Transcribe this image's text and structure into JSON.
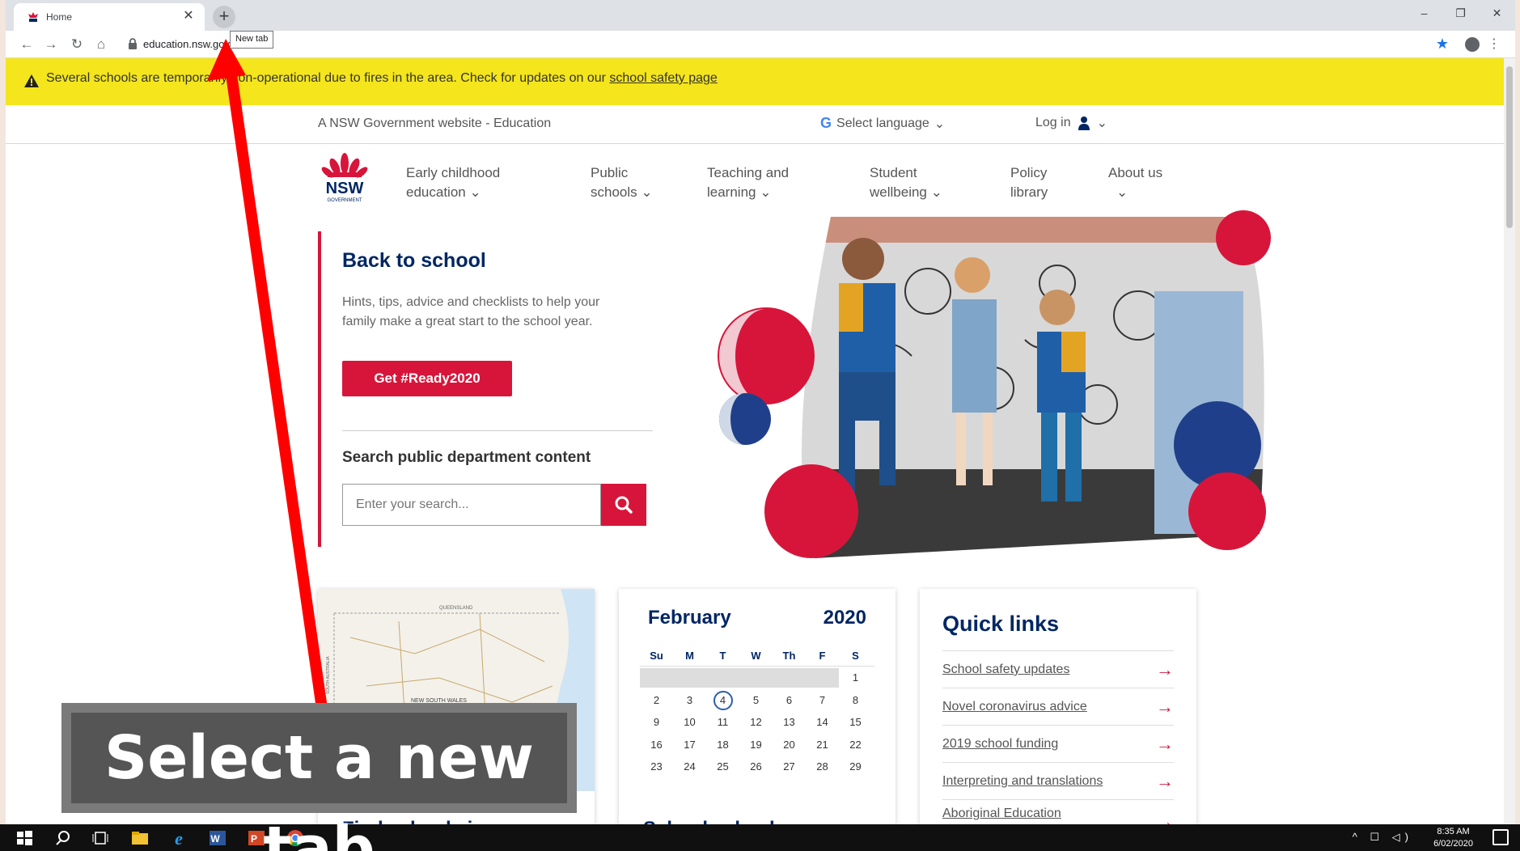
{
  "browser": {
    "tab_title": "Home",
    "close_glyph": "✕",
    "newtab_glyph": "+",
    "tooltip": "New tab",
    "url": "education.nsw.gov",
    "win_minimize": "–",
    "win_restore": "❐",
    "win_close": "✕",
    "back": "←",
    "forward": "→",
    "reload": "↻",
    "home": "⌂",
    "star": "★",
    "menu": "⋮"
  },
  "alert": {
    "text": "Several schools are temporarily non-operational due to fires in the area. Check for updates on our ",
    "link": "school safety page"
  },
  "topbar": {
    "site_label": "A NSW Government website - Education",
    "language": "Select language",
    "login": "Log in",
    "chevron": "⌄"
  },
  "nav": [
    {
      "line1": "Early childhood",
      "line2": "education"
    },
    {
      "line1": "Public",
      "line2": "schools"
    },
    {
      "line1": "Teaching and",
      "line2": "learning"
    },
    {
      "line1": "Student",
      "line2": "wellbeing"
    },
    {
      "line1": "Policy",
      "line2": "library"
    },
    {
      "line1": "About us",
      "line2": ""
    }
  ],
  "nav_chevron": "⌄",
  "logo": {
    "text": "NSW",
    "sub": "GOVERNMENT"
  },
  "hero": {
    "title": "Back to school",
    "desc": "Hints, tips, advice and checklists to help your family make a great start to the school year.",
    "cta": "Get #Ready2020",
    "search_title": "Search public department content",
    "search_placeholder": "Enter your search..."
  },
  "map_card": {
    "bottom_title": "Find schools in",
    "labels": {
      "region1": "QUEENSLAND",
      "region2": "NEW SOUTH WALES",
      "region3": "SOUTH AUSTRALIA"
    }
  },
  "calendar": {
    "month": "February",
    "year": "2020",
    "days": [
      "Su",
      "M",
      "T",
      "W",
      "Th",
      "F",
      "S"
    ],
    "weeks": [
      [
        "",
        "",
        "",
        "",
        "",
        "",
        "1"
      ],
      [
        "2",
        "3",
        "4",
        "5",
        "6",
        "7",
        "8"
      ],
      [
        "9",
        "10",
        "11",
        "12",
        "13",
        "14",
        "15"
      ],
      [
        "16",
        "17",
        "18",
        "19",
        "20",
        "21",
        "22"
      ],
      [
        "23",
        "24",
        "25",
        "26",
        "27",
        "28",
        "29"
      ]
    ],
    "today": "4",
    "bottom_title": "School calendar"
  },
  "quick_links": {
    "title": "Quick links",
    "items": [
      "School safety updates",
      "Novel coronavirus advice",
      "2019 school funding",
      "Interpreting and translations",
      "Aboriginal Education"
    ],
    "arrow": "→"
  },
  "caption": "Select a new tab",
  "taskbar": {
    "time": "8:35 AM",
    "date": "6/02/2020",
    "tray": "^ ☐ ◁)"
  },
  "colors": {
    "nsw_red": "#d7153a",
    "nsw_blue": "#002664",
    "alert_yellow": "#f4e51c",
    "annotation_arrow": "#ff0000"
  }
}
